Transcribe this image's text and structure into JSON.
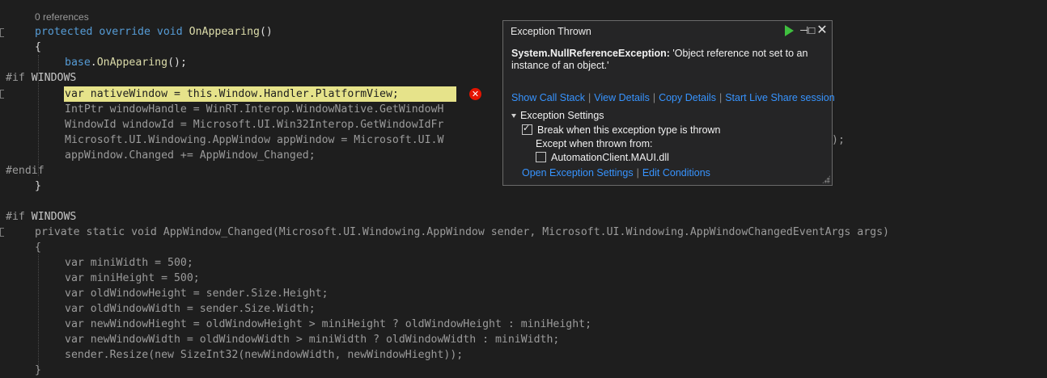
{
  "editor": {
    "codelens": "0 references",
    "lines": {
      "l1_kw1": "protected",
      "l1_kw2": "override",
      "l1_kw3": "void",
      "l1_fn": "OnAppearing",
      "l1_rest": "()",
      "l2": "{",
      "l3_base": "base",
      "l3_dot": ".",
      "l3_fn": "OnAppearing",
      "l3_rest": "();",
      "l4_pp": "#if",
      "l4_name": "WINDOWS",
      "l5": "var nativeWindow = this.Window.Handler.PlatformView;",
      "l6": "IntPtr windowHandle = WinRT.Interop.WindowNative.GetWindowH",
      "l7": "WindowId windowId = Microsoft.UI.Win32Interop.GetWindowIdFr",
      "l8": "Microsoft.UI.Windowing.AppWindow appWindow = Microsoft.UI.W",
      "l8_tail": ");",
      "l9": "appWindow.Changed += AppWindow_Changed;",
      "l10": "#endif",
      "l11": "}",
      "l12_pp": "#if",
      "l12_name": "WINDOWS",
      "l13": "private static void AppWindow_Changed(Microsoft.UI.Windowing.AppWindow sender, Microsoft.UI.Windowing.AppWindowChangedEventArgs args)",
      "l14": "{",
      "l15": "var miniWidth = 500;",
      "l16": "var miniHeight = 500;",
      "l17": "var oldWindowHeight = sender.Size.Height;",
      "l18": "var oldWindowWidth = sender.Size.Width;",
      "l19": "var newWindowHieght = oldWindowHeight > miniHeight ? oldWindowHeight : miniHeight;",
      "l20": "var newWindowWidth = oldWindowWidth > miniWidth ? oldWindowWidth : miniWidth;",
      "l21": "sender.Resize(new SizeInt32(newWindowWidth, newWindowHieght));",
      "l22": "}"
    },
    "error_glyph": "✕"
  },
  "popup": {
    "title": "Exception Thrown",
    "pin_glyph": "⊣□",
    "close_glyph": "✕",
    "exception_type": "System.NullReferenceException:",
    "exception_message": " 'Object reference not set to an instance of an object.'",
    "links": [
      "Show Call Stack",
      "View Details",
      "Copy Details",
      "Start Live Share session"
    ],
    "separator": "|",
    "settings_header": "Exception Settings",
    "break_label": "Break when this exception type is thrown",
    "except_label": "Except when thrown from:",
    "module_label": "AutomationClient.MAUI.dll",
    "bottom_links": [
      "Open Exception Settings",
      "Edit Conditions"
    ],
    "break_checked": true,
    "module_checked": false
  },
  "colors": {
    "background": "#1e1e1e",
    "keyword": "#569cd6",
    "function": "#dcdcaa",
    "highlight": "#e6e38a",
    "error": "#e51400",
    "link": "#3794ff"
  }
}
